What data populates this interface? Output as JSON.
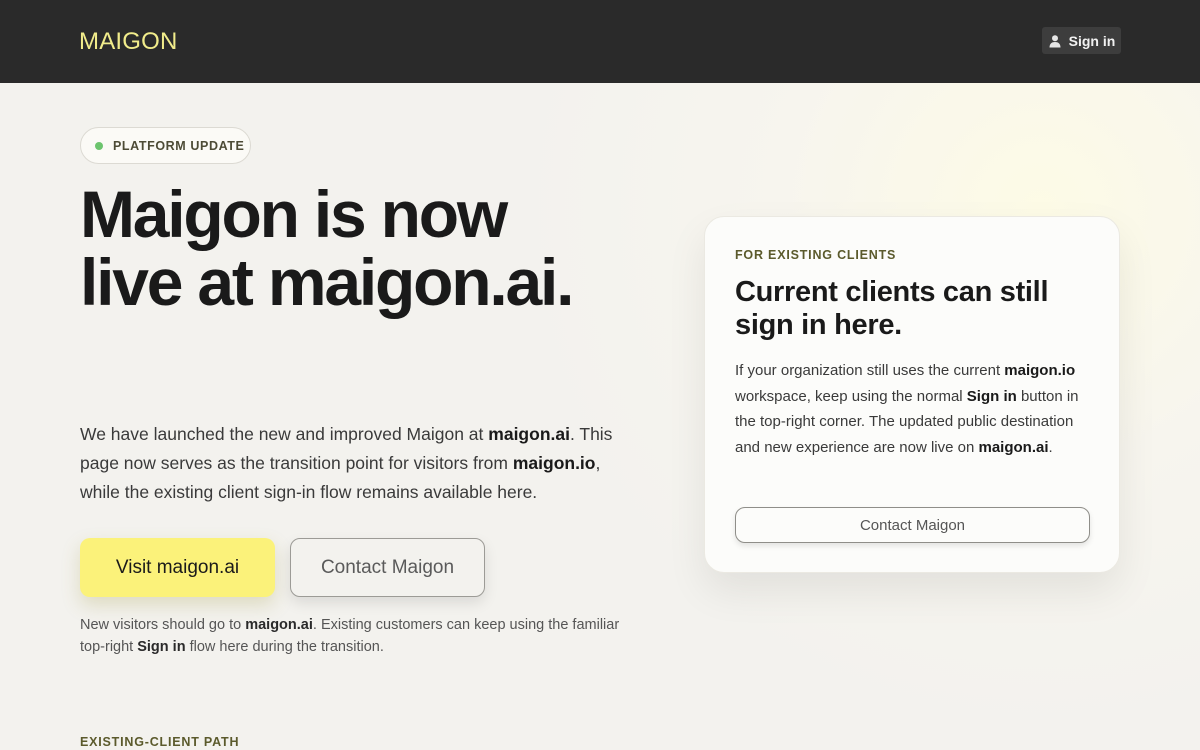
{
  "header": {
    "logo": "MAIGON",
    "signin_label": "Sign in"
  },
  "hero": {
    "badge": "PLATFORM UPDATE",
    "headline": "Maigon is now live at maigon.ai.",
    "lead": {
      "p1": "We have launched the new and improved Maigon at ",
      "b1": "maigon.ai",
      "p2": ". This page now serves as the transition point for visitors from ",
      "b2": "maigon.io",
      "p3": ", while the existing client sign-in flow remains available here."
    },
    "primary_button": "Visit maigon.ai",
    "secondary_button": "Contact Maigon",
    "note": {
      "p1": "New visitors should go to ",
      "b1": "maigon.ai",
      "p2": ". Existing customers can keep using the familiar top-right ",
      "b2": "Sign in",
      "p3": " flow here during the transition."
    },
    "section_label": "EXISTING-CLIENT PATH"
  },
  "card": {
    "eyebrow": "FOR EXISTING CLIENTS",
    "title": "Current clients can still sign in here.",
    "body": {
      "p1": "If your organization still uses the current ",
      "b1": "maigon.io",
      "p2": " workspace, keep using the normal ",
      "b2": "Sign in",
      "p3": " button in the top-right corner. The updated public destination and new experience are now live on ",
      "b3": "maigon.ai",
      "p4": "."
    },
    "button": "Contact Maigon"
  },
  "colors": {
    "header_bg": "#2a2a2a",
    "logo": "#f1ec8b",
    "primary_button_bg": "#fbf27a",
    "status_dot": "#6cc46e",
    "eyebrow_text": "#5b5a2c"
  },
  "icons": {
    "signin": "user-icon",
    "badge": "status-dot"
  }
}
